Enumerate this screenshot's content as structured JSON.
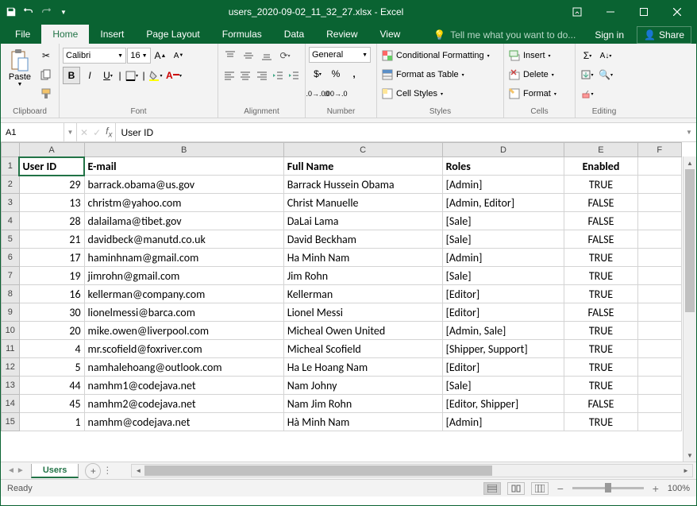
{
  "title": "users_2020-09-02_11_32_27.xlsx - Excel",
  "menu": {
    "file": "File",
    "home": "Home",
    "insert": "Insert",
    "page_layout": "Page Layout",
    "formulas": "Formulas",
    "data": "Data",
    "review": "Review",
    "view": "View"
  },
  "tell_me": "Tell me what you want to do...",
  "signin": "Sign in",
  "share": "Share",
  "ribbon": {
    "clipboard": {
      "label": "Clipboard",
      "paste": "Paste"
    },
    "font": {
      "label": "Font",
      "name": "Calibri",
      "size": "16"
    },
    "alignment": {
      "label": "Alignment"
    },
    "number": {
      "label": "Number",
      "format": "General"
    },
    "styles": {
      "label": "Styles",
      "conditional": "Conditional Formatting",
      "table": "Format as Table",
      "cell": "Cell Styles"
    },
    "cells": {
      "label": "Cells",
      "insert": "Insert",
      "delete": "Delete",
      "format": "Format"
    },
    "editing": {
      "label": "Editing"
    }
  },
  "name_box": "A1",
  "formula_value": "User ID",
  "columns": [
    "A",
    "B",
    "C",
    "D",
    "E",
    "F"
  ],
  "headers": {
    "A": "User ID",
    "B": "E-mail",
    "C": "Full Name",
    "D": "Roles",
    "E": "Enabled"
  },
  "rows": [
    {
      "n": 2,
      "A": "29",
      "B": "barrack.obama@us.gov",
      "C": "Barrack Hussein Obama",
      "D": "[Admin]",
      "E": "TRUE"
    },
    {
      "n": 3,
      "A": "13",
      "B": "christm@yahoo.com",
      "C": "Christ Manuelle",
      "D": "[Admin, Editor]",
      "E": "FALSE"
    },
    {
      "n": 4,
      "A": "28",
      "B": "dalailama@tibet.gov",
      "C": "DaLai Lama",
      "D": "[Sale]",
      "E": "FALSE"
    },
    {
      "n": 5,
      "A": "21",
      "B": "davidbeck@manutd.co.uk",
      "C": "David Beckham",
      "D": "[Sale]",
      "E": "FALSE"
    },
    {
      "n": 6,
      "A": "17",
      "B": "haminhnam@gmail.com",
      "C": "Ha Minh Nam",
      "D": "[Admin]",
      "E": "TRUE"
    },
    {
      "n": 7,
      "A": "19",
      "B": "jimrohn@gmail.com",
      "C": "Jim Rohn",
      "D": "[Sale]",
      "E": "TRUE"
    },
    {
      "n": 8,
      "A": "16",
      "B": "kellerman@company.com",
      "C": "Kellerman",
      "D": "[Editor]",
      "E": "TRUE"
    },
    {
      "n": 9,
      "A": "30",
      "B": "lionelmessi@barca.com",
      "C": "Lionel Messi",
      "D": "[Editor]",
      "E": "FALSE"
    },
    {
      "n": 10,
      "A": "20",
      "B": "mike.owen@liverpool.com",
      "C": "Micheal Owen United",
      "D": "[Admin, Sale]",
      "E": "TRUE"
    },
    {
      "n": 11,
      "A": "4",
      "B": "mr.scofield@foxriver.com",
      "C": "Micheal Scofield",
      "D": "[Shipper, Support]",
      "E": "TRUE"
    },
    {
      "n": 12,
      "A": "5",
      "B": "namhalehoang@outlook.com",
      "C": "Ha Le Hoang Nam",
      "D": "[Editor]",
      "E": "TRUE"
    },
    {
      "n": 13,
      "A": "44",
      "B": "namhm1@codejava.net",
      "C": "Nam Johny",
      "D": "[Sale]",
      "E": "TRUE"
    },
    {
      "n": 14,
      "A": "45",
      "B": "namhm2@codejava.net",
      "C": "Nam Jim Rohn",
      "D": "[Editor, Shipper]",
      "E": "FALSE"
    },
    {
      "n": 15,
      "A": "1",
      "B": "namhm@codejava.net",
      "C": "Hà Minh Nam",
      "D": "[Admin]",
      "E": "TRUE"
    }
  ],
  "sheet": "Users",
  "status": "Ready",
  "zoom": "100%"
}
